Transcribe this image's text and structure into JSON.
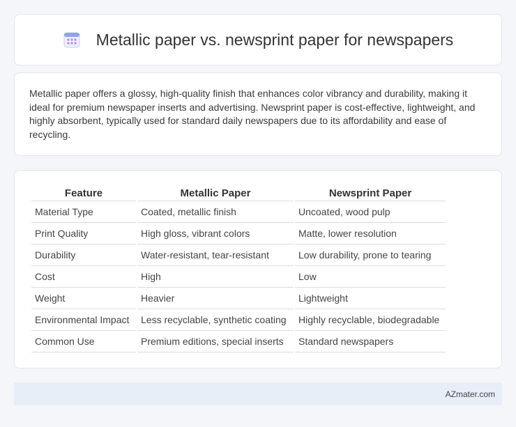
{
  "header": {
    "icon": "calendar-icon",
    "title": "Metallic paper vs. newsprint paper for newspapers"
  },
  "summary": {
    "text": "Metallic paper offers a glossy, high-quality finish that enhances color vibrancy and durability, making it ideal for premium newspaper inserts and advertising. Newsprint paper is cost-effective, lightweight, and highly absorbent, typically used for standard daily newspapers due to its affordability and ease of recycling."
  },
  "table": {
    "headers": [
      "Feature",
      "Metallic Paper",
      "Newsprint Paper"
    ],
    "rows": [
      [
        "Material Type",
        "Coated, metallic finish",
        "Uncoated, wood pulp"
      ],
      [
        "Print Quality",
        "High gloss, vibrant colors",
        "Matte, lower resolution"
      ],
      [
        "Durability",
        "Water-resistant, tear-resistant",
        "Low durability, prone to tearing"
      ],
      [
        "Cost",
        "High",
        "Low"
      ],
      [
        "Weight",
        "Heavier",
        "Lightweight"
      ],
      [
        "Environmental Impact",
        "Less recyclable, synthetic coating",
        "Highly recyclable, biodegradable"
      ],
      [
        "Common Use",
        "Premium editions, special inserts",
        "Standard newspapers"
      ]
    ]
  },
  "footer": {
    "brand": "AZmater.com"
  },
  "colors": {
    "background": "#f4f6fa",
    "card": "#ffffff",
    "footer": "#e8eef7",
    "icon_accent": "#7b8cde"
  }
}
